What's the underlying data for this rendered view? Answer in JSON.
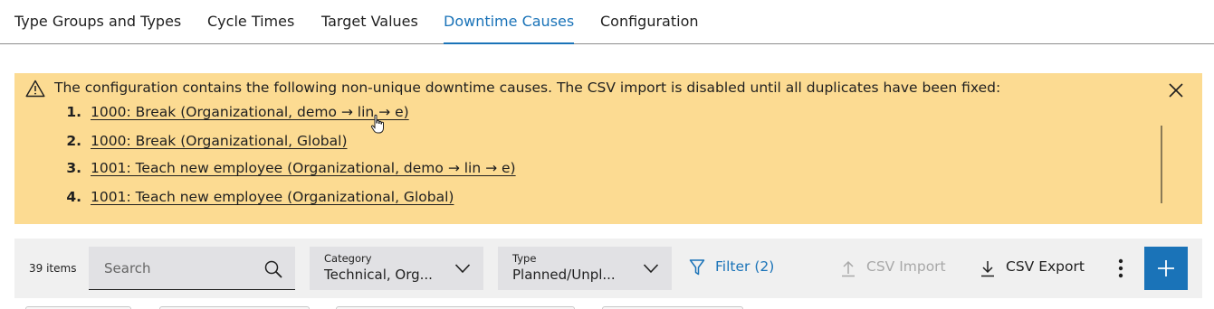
{
  "tabs": [
    {
      "label": "Type Groups and Types",
      "active": false
    },
    {
      "label": "Cycle Times",
      "active": false
    },
    {
      "label": "Target Values",
      "active": false
    },
    {
      "label": "Downtime Causes",
      "active": true
    },
    {
      "label": "Configuration",
      "active": false
    }
  ],
  "banner": {
    "message": "The configuration contains the following non-unique downtime causes. The CSV import is disabled until all duplicates have been fixed:",
    "items": [
      {
        "number": "1.",
        "text": "1000: Break (Organizational, demo → lin → e)"
      },
      {
        "number": "2.",
        "text": "1000: Break (Organizational, Global)"
      },
      {
        "number": "3.",
        "text": "1001: Teach new employee (Organizational, demo → lin → e)"
      },
      {
        "number": "4.",
        "text": "1001: Teach new employee (Organizational, Global)"
      }
    ],
    "icons": {
      "warning": "warning-triangle-icon",
      "close": "close-icon"
    }
  },
  "toolbar": {
    "item_count": "39 items",
    "search_placeholder": "Search",
    "category": {
      "label": "Category",
      "value": "Technical, Org..."
    },
    "type": {
      "label": "Type",
      "value": "Planned/Unpl..."
    },
    "filter_label": "Filter (2)",
    "csv_import_label": "CSV Import",
    "csv_export_label": "CSV Export"
  },
  "colors": {
    "accent": "#1a73b8",
    "warning_bg": "#fcdb92",
    "toolbar_bg": "#f0f0f0",
    "input_bg": "#e1e1e4",
    "disabled_text": "#a8a8a8"
  }
}
